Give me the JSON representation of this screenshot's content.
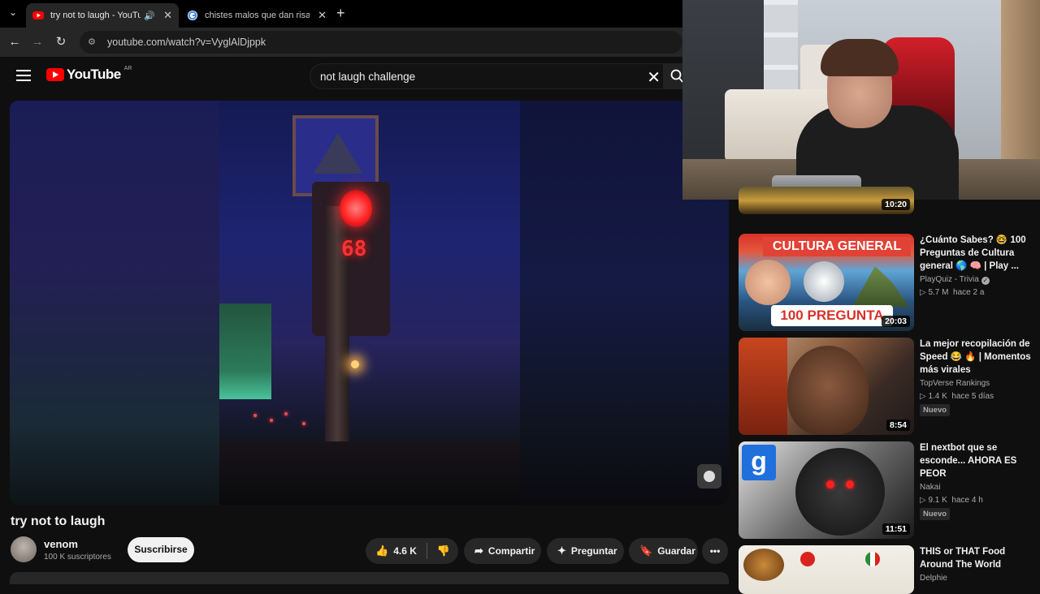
{
  "browser": {
    "tabs": [
      {
        "title": "try not to laugh - YouTube",
        "active": true
      },
      {
        "title": "chistes malos que dan risa - Bu",
        "active": false
      }
    ],
    "url": "youtube.com/watch?v=VyglAlDjppk"
  },
  "header": {
    "logo_text": "YouTube",
    "country_code": "AR",
    "search_query": "not laugh challenge"
  },
  "player": {
    "counter_digits": "68"
  },
  "video": {
    "title": "try not to laugh",
    "channel_name": "venom",
    "subscribers": "100 K suscriptores",
    "subscribe_label": "Suscribirse",
    "likes": "4.6 K",
    "share_label": "Compartir",
    "ask_label": "Preguntar",
    "save_label": "Guardar"
  },
  "recommendations": [
    {
      "duration": "10:20"
    },
    {
      "title": "¿Cuánto Sabes? 🤓 100 Preguntas de Cultura general 🌎 🧠 | Play ...",
      "channel": "PlayQuiz - Trivia",
      "verified": true,
      "views": "5.7 M",
      "age": "hace 2 a",
      "duration": "20:03",
      "thumb_text_top": "CULTURA GENERAL",
      "thumb_text_bottom": "100 PREGUNTA"
    },
    {
      "title": "La mejor recopilación de Speed 😂 🔥 | Momentos más virales",
      "channel": "TopVerse Rankings",
      "views": "1.4 K",
      "age": "hace 5 días",
      "badge": "Nuevo",
      "duration": "8:54"
    },
    {
      "title": "El nextbot que se esconde... AHORA ES PEOR",
      "channel": "Nakai",
      "views": "9.1 K",
      "age": "hace 4 h",
      "badge": "Nuevo",
      "duration": "11:51",
      "thumb_letter": "g"
    },
    {
      "title": "THIS or THAT Food Around The World",
      "channel": "Delphie"
    }
  ]
}
